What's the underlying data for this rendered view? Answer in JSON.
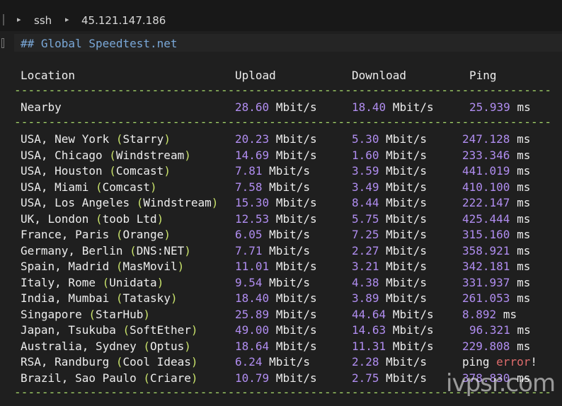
{
  "breadcrumb": [
    "ssh",
    "45.121.147.186"
  ],
  "heading": "## Global Speedtest.net",
  "columns": {
    "location": "Location",
    "upload": "Upload",
    "download": "Download",
    "ping": "Ping"
  },
  "dash_line": "------------------------------------------------------------------------------",
  "unit_mbit": "Mbit/s",
  "unit_ms": "ms",
  "nearby": {
    "label": "Nearby",
    "upload": "28.60",
    "download": "18.40",
    "ping": "25.939"
  },
  "rows": [
    {
      "place": "USA, New York",
      "isp": "Starry",
      "upload": "20.23",
      "download": "5.30",
      "ping": "247.128"
    },
    {
      "place": "USA, Chicago",
      "isp": "Windstream",
      "upload": "14.69",
      "download": "1.60",
      "ping": "233.346"
    },
    {
      "place": "USA, Houston",
      "isp": "Comcast",
      "upload": "7.81",
      "download": "3.59",
      "ping": "441.019"
    },
    {
      "place": "USA, Miami",
      "isp": "Comcast",
      "upload": "7.58",
      "download": "3.49",
      "ping": "410.100"
    },
    {
      "place": "USA, Los Angeles",
      "isp": "Windstream",
      "upload": "15.30",
      "download": "8.44",
      "ping": "222.147"
    },
    {
      "place": "UK, London",
      "isp": "toob Ltd",
      "upload": "12.53",
      "download": "5.75",
      "ping": "425.444"
    },
    {
      "place": "France, Paris",
      "isp": "Orange",
      "upload": "6.05",
      "download": "7.25",
      "ping": "315.160"
    },
    {
      "place": "Germany, Berlin",
      "isp": "DNS:NET",
      "upload": "7.71",
      "download": "2.27",
      "ping": "358.921"
    },
    {
      "place": "Spain, Madrid",
      "isp": "MasMovil",
      "upload": "11.01",
      "download": "3.21",
      "ping": "342.181"
    },
    {
      "place": "Italy, Rome",
      "isp": "Unidata",
      "upload": "9.54",
      "download": "4.38",
      "ping": "331.937"
    },
    {
      "place": "India, Mumbai",
      "isp": "Tatasky",
      "upload": "18.40",
      "download": "3.89",
      "ping": "261.053"
    },
    {
      "place": "Singapore",
      "isp": "StarHub",
      "upload": "25.89",
      "download": "44.64",
      "ping": "8.892"
    },
    {
      "place": "Japan, Tsukuba",
      "isp": "SoftEther",
      "upload": "49.00",
      "download": "14.63",
      "ping": "96.321"
    },
    {
      "place": "Australia, Sydney",
      "isp": "Optus",
      "upload": "18.64",
      "download": "11.31",
      "ping": "229.808"
    },
    {
      "place": "RSA, Randburg",
      "isp": "Cool Ideas",
      "upload": "6.24",
      "download": "2.28",
      "ping": "ping error!"
    },
    {
      "place": "Brazil, Sao Paulo",
      "isp": "Criare",
      "upload": "10.79",
      "download": "2.75",
      "ping": "378.830"
    }
  ],
  "watermark": "ivpsr.com",
  "colors": {
    "background": "#1f1f1f",
    "number": "#b08df0",
    "paren": "#c9e36b",
    "dash": "#a7d96a",
    "heading": "#7aa8d8",
    "error": "#e06c6c"
  }
}
